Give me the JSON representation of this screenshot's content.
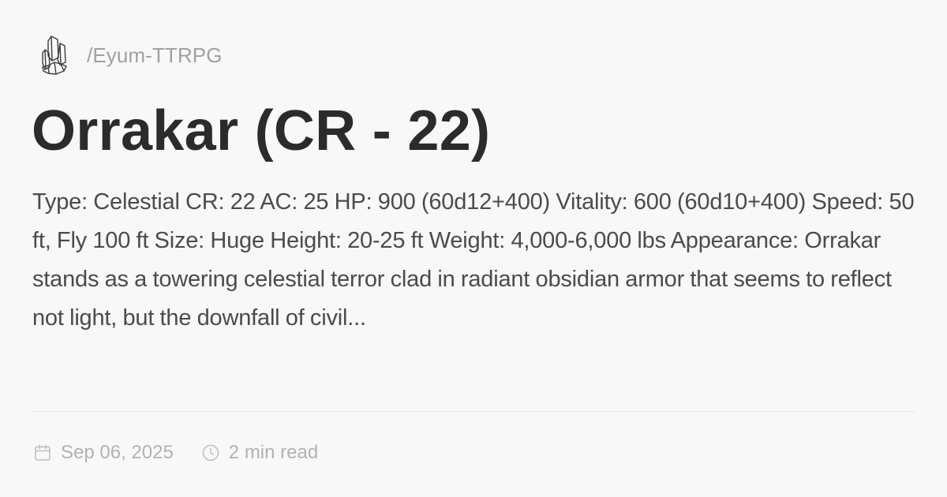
{
  "site": {
    "logo_icon": "crystal-cluster-icon",
    "name": "/Eyum-TTRPG"
  },
  "article": {
    "title": "Orrakar (CR - 22)",
    "description": "Type: Celestial CR: 22 AC: 25 HP: 900 (60d12+400) Vitality: 600 (60d10+400) Speed: 50 ft, Fly 100 ft Size: Huge Height: 20-25 ft Weight: 4,000-6,000 lbs Appearance: Orrakar stands as a towering celestial terror clad in radiant obsidian armor that seems to reflect not light, but the downfall of civil..."
  },
  "meta": {
    "date_icon": "calendar-icon",
    "date": "Sep 06, 2025",
    "read_icon": "clock-icon",
    "read_time": "2 min read"
  },
  "colors": {
    "background": "#f8f8f9",
    "title": "#2b2b2b",
    "body_text": "#4b4b4d",
    "muted_text": "#a1a1a4"
  }
}
